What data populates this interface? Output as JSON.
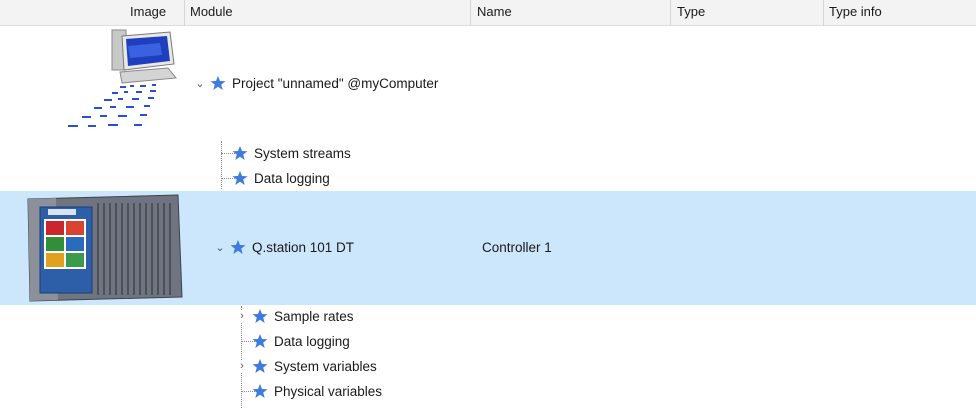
{
  "columns": {
    "image": "Image",
    "module": "Module",
    "name": "Name",
    "type": "Type",
    "type_info": "Type info"
  },
  "tree": {
    "project": {
      "label": "Project \"unnamed\" @myComputer",
      "icon": "computer-image"
    },
    "project_children": [
      {
        "label": "System streams"
      },
      {
        "label": "Data logging"
      }
    ],
    "station": {
      "label": "Q.station 101 DT",
      "name": "Controller 1",
      "icon": "qstation-device-image",
      "selected": true
    },
    "station_children": [
      {
        "label": "Sample rates",
        "expandable": true
      },
      {
        "label": "Data logging",
        "expandable": false
      },
      {
        "label": "System variables",
        "expandable": true
      },
      {
        "label": "Physical variables",
        "expandable": false
      }
    ]
  },
  "colors": {
    "selection": "#cce6fb",
    "star": "#3d7be0",
    "header_bg": "#f3f3f3"
  }
}
